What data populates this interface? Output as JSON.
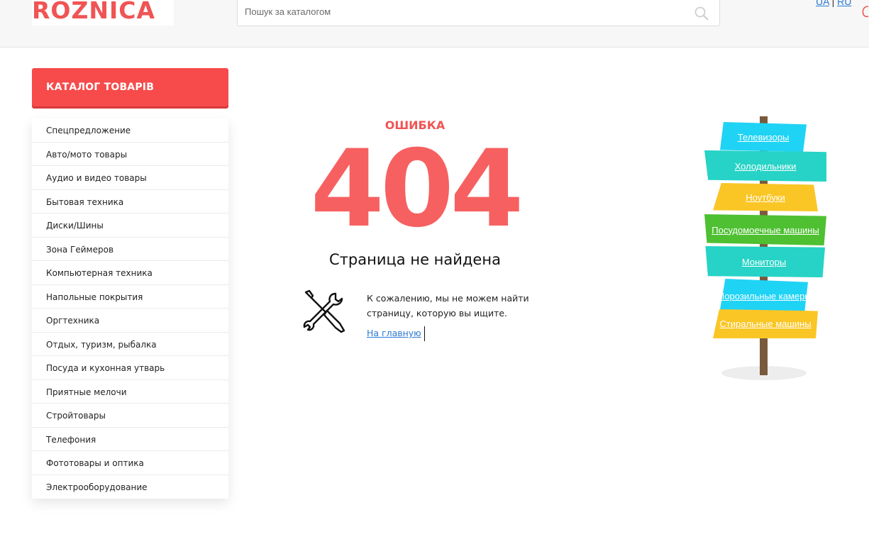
{
  "header": {
    "logo": "ROZNICA",
    "search_placeholder": "Пошук за каталогом",
    "lang_ua": "UA",
    "lang_sep": "|",
    "lang_ru": "RU"
  },
  "sidebar": {
    "catalog_button": "КАТАЛОГ ТОВАРІВ",
    "items": [
      {
        "label": "Спецпредложение"
      },
      {
        "label": "Авто/мото товары"
      },
      {
        "label": "Аудио и видео товары"
      },
      {
        "label": "Бытовая техника"
      },
      {
        "label": "Диски/Шины"
      },
      {
        "label": "Зона Геймеров"
      },
      {
        "label": "Компьютерная техника"
      },
      {
        "label": "Напольные покрытия"
      },
      {
        "label": "Оргтехника"
      },
      {
        "label": "Отдых, туризм, рыбалка"
      },
      {
        "label": "Посуда и кухонная утварь"
      },
      {
        "label": "Приятные мелочи"
      },
      {
        "label": "Стройтовары"
      },
      {
        "label": "Телефония"
      },
      {
        "label": "Фототовары и оптика"
      },
      {
        "label": "Электрооборудование"
      }
    ]
  },
  "main": {
    "error_label": "ОШИБКА",
    "error_code": "404",
    "title": "Страница не найдена",
    "message": "К сожалению, мы не можем найти страницу, которую вы ищите.",
    "home_link": "На главную"
  },
  "signpost": {
    "signs": [
      {
        "label": "Телевизоры",
        "color": "#1fd3f5"
      },
      {
        "label": "Холодильники",
        "color": "#27d3c6"
      },
      {
        "label": "Ноутбуки",
        "color": "#fac626"
      },
      {
        "label": "Посудомоечные машины",
        "color": "#4ec032"
      },
      {
        "label": "Мониторы",
        "color": "#27d3c6"
      },
      {
        "label": "Морозильные камеры",
        "color": "#1fd3f5"
      },
      {
        "label": "Стиральные машины",
        "color": "#fac626"
      }
    ]
  },
  "colors": {
    "accent": "#f74b4b",
    "error_number": "#f76060",
    "link": "#2a7ad1"
  }
}
